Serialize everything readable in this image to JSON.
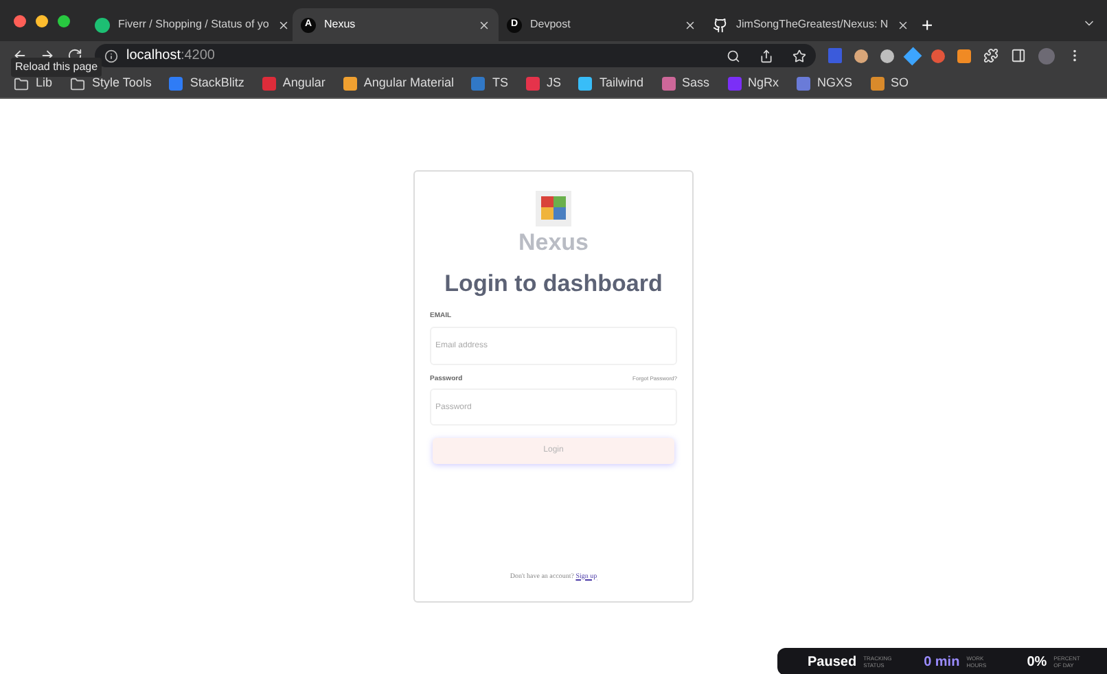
{
  "tabs": [
    {
      "title": "Fiverr / Shopping / Status of yo",
      "kind": "fiverr",
      "selected": false
    },
    {
      "title": "Nexus",
      "kind": "letter",
      "icon_text": "A",
      "selected": true
    },
    {
      "title": "Devpost",
      "kind": "letter",
      "icon_text": "D",
      "selected": false
    },
    {
      "title": "JimSongTheGreatest/Nexus: N",
      "kind": "github",
      "selected": false
    }
  ],
  "new_tab": "+",
  "address": {
    "host": "localhost",
    "port": ":4200"
  },
  "tooltip": "Reload this page",
  "bookmarks": [
    {
      "label": "Lib",
      "kind": "folder"
    },
    {
      "label": "Style Tools",
      "kind": "folder"
    },
    {
      "label": "StackBlitz",
      "kind": "badge",
      "color": "#2f7cf6"
    },
    {
      "label": "Angular",
      "kind": "badge",
      "color": "#dd2c3a"
    },
    {
      "label": "Angular Material",
      "kind": "badge",
      "color": "#f0a030"
    },
    {
      "label": "TS",
      "kind": "badge",
      "color": "#3178c6"
    },
    {
      "label": "JS",
      "kind": "badge",
      "color": "#e5334b"
    },
    {
      "label": "Tailwind",
      "kind": "badge",
      "color": "#38bdf8"
    },
    {
      "label": "Sass",
      "kind": "badge",
      "color": "#cd6799"
    },
    {
      "label": "NgRx",
      "kind": "badge",
      "color": "#7b2ff7"
    },
    {
      "label": "NGXS",
      "kind": "badge",
      "color": "#6a7bd8"
    },
    {
      "label": "SO",
      "kind": "badge",
      "color": "#d98a2b"
    }
  ],
  "card": {
    "brand": "Nexus",
    "heading": "Login to dashboard",
    "email": {
      "label": "EMAIL",
      "placeholder": "Email address"
    },
    "password": {
      "label": "Password",
      "placeholder": "Password",
      "forgot": "Forgot Password?"
    },
    "login": {
      "label": "Login",
      "disabled": true
    },
    "footer": {
      "text": "Don't have an account?",
      "link": "Sign up"
    }
  },
  "tracker": [
    {
      "value": "Paused",
      "caption": "TRACKING STATUS",
      "kind": "status"
    },
    {
      "value": "0 min",
      "caption": "WORK HOURS",
      "kind": "accent"
    },
    {
      "value": "0%",
      "caption": "PERCENT OF DAY",
      "kind": "plain"
    }
  ]
}
